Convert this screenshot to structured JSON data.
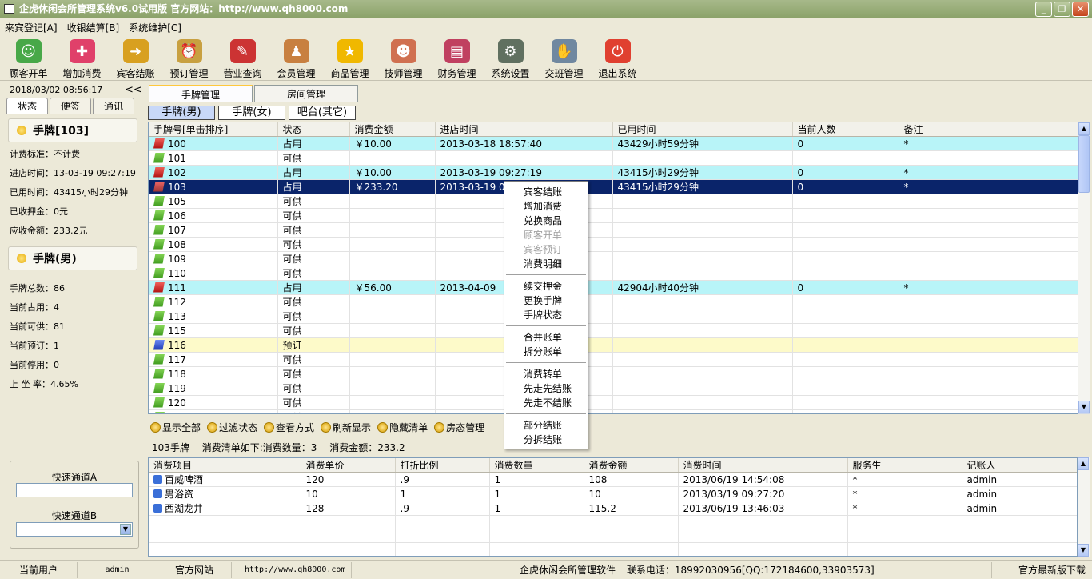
{
  "window": {
    "title": "企虎休闲会所管理系统v6.0试用版   官方网站：http://www.qh8000.com"
  },
  "menu": [
    "来宾登记[A]",
    "收银结算[B]",
    "系统维护[C]"
  ],
  "toolbar": [
    {
      "label": "顾客开单",
      "icon": "customer-icon",
      "color": "#48a848"
    },
    {
      "label": "增加消费",
      "icon": "add-icon",
      "color": "#e0406a"
    },
    {
      "label": "宾客结账",
      "icon": "checkout-icon",
      "color": "#d8a020"
    },
    {
      "label": "预订管理",
      "icon": "alarm-clock-icon",
      "color": "#c8a040"
    },
    {
      "label": "营业查询",
      "icon": "search-doc-icon",
      "color": "#cc3333"
    },
    {
      "label": "会员管理",
      "icon": "members-icon",
      "color": "#c88040"
    },
    {
      "label": "商品管理",
      "icon": "star-icon",
      "color": "#f0b800"
    },
    {
      "label": "技师管理",
      "icon": "staff-icon",
      "color": "#d07050"
    },
    {
      "label": "财务管理",
      "icon": "finance-icon",
      "color": "#c04060"
    },
    {
      "label": "系统设置",
      "icon": "settings-icon",
      "color": "#607060"
    },
    {
      "label": "交班管理",
      "icon": "handshake-icon",
      "color": "#7088a0"
    },
    {
      "label": "退出系统",
      "icon": "power-icon",
      "color": "#e04030"
    }
  ],
  "left": {
    "datetime": "2018/03/02 08:56:17",
    "collapse": "<<",
    "tabs": [
      "状态",
      "便签",
      "通讯"
    ],
    "card_title": "手牌[103]",
    "card": [
      "计费标准：不计费",
      "进店时间：13-03-19 09:27:19",
      "已用时间：43415小时29分钟",
      "已收押金：0元",
      "应收金额：233.2元"
    ],
    "group_title": "手牌(男)",
    "stats": [
      "手牌总数：86",
      "当前占用：4",
      "当前可供：81",
      "当前预订：1",
      "当前停用：0",
      "上 坐 率：4.65%"
    ],
    "quick_a": "快速通道A",
    "quick_b": "快速通道B"
  },
  "main_tabs": [
    "手牌管理",
    "房间管理"
  ],
  "sub_tabs": [
    "手牌(男)",
    "手牌(女)",
    "吧台(其它)"
  ],
  "grid": {
    "columns": [
      "手牌号[单击排序]",
      "状态",
      "消费金额",
      "进店时间",
      "已用时间",
      "当前人数",
      "备注"
    ],
    "rows": [
      {
        "flag": "red",
        "state": "occ",
        "cells": [
          "100",
          "占用",
          "￥10.00",
          "2013-03-18 18:57:40",
          "43429小时59分钟",
          "0",
          "*"
        ]
      },
      {
        "flag": "green",
        "state": "",
        "cells": [
          "101",
          "可供",
          "",
          "",
          "",
          "",
          ""
        ]
      },
      {
        "flag": "red",
        "state": "occ",
        "cells": [
          "102",
          "占用",
          "￥10.00",
          "2013-03-19 09:27:19",
          "43415小时29分钟",
          "0",
          "*"
        ]
      },
      {
        "flag": "redsel",
        "state": "sel",
        "cells": [
          "103",
          "占用",
          "￥233.20",
          "2013-03-19 09:27:19",
          "43415小时29分钟",
          "0",
          "*"
        ]
      },
      {
        "flag": "green",
        "state": "",
        "cells": [
          "105",
          "可供",
          "",
          "",
          "",
          "",
          ""
        ]
      },
      {
        "flag": "green",
        "state": "",
        "cells": [
          "106",
          "可供",
          "",
          "",
          "",
          "",
          ""
        ]
      },
      {
        "flag": "green",
        "state": "",
        "cells": [
          "107",
          "可供",
          "",
          "",
          "",
          "",
          ""
        ]
      },
      {
        "flag": "green",
        "state": "",
        "cells": [
          "108",
          "可供",
          "",
          "",
          "",
          "",
          ""
        ]
      },
      {
        "flag": "green",
        "state": "",
        "cells": [
          "109",
          "可供",
          "",
          "",
          "",
          "",
          ""
        ]
      },
      {
        "flag": "green",
        "state": "",
        "cells": [
          "110",
          "可供",
          "",
          "",
          "",
          "",
          ""
        ]
      },
      {
        "flag": "red",
        "state": "occ",
        "cells": [
          "111",
          "占用",
          "￥56.00",
          "2013-04-09",
          "42904小时40分钟",
          "0",
          "*"
        ]
      },
      {
        "flag": "green",
        "state": "",
        "cells": [
          "112",
          "可供",
          "",
          "",
          "",
          "",
          ""
        ]
      },
      {
        "flag": "green",
        "state": "",
        "cells": [
          "113",
          "可供",
          "",
          "",
          "",
          "",
          ""
        ]
      },
      {
        "flag": "green",
        "state": "",
        "cells": [
          "115",
          "可供",
          "",
          "",
          "",
          "",
          ""
        ]
      },
      {
        "flag": "blue",
        "state": "rsv",
        "cells": [
          "116",
          "预订",
          "",
          "",
          "",
          "",
          ""
        ]
      },
      {
        "flag": "green",
        "state": "",
        "cells": [
          "117",
          "可供",
          "",
          "",
          "",
          "",
          ""
        ]
      },
      {
        "flag": "green",
        "state": "",
        "cells": [
          "118",
          "可供",
          "",
          "",
          "",
          "",
          ""
        ]
      },
      {
        "flag": "green",
        "state": "",
        "cells": [
          "119",
          "可供",
          "",
          "",
          "",
          "",
          ""
        ]
      },
      {
        "flag": "green",
        "state": "",
        "cells": [
          "120",
          "可供",
          "",
          "",
          "",
          "",
          ""
        ]
      },
      {
        "flag": "green",
        "state": "",
        "cells": [
          "121",
          "可供",
          "",
          "",
          "",
          "",
          ""
        ]
      },
      {
        "flag": "green",
        "state": "",
        "cells": [
          "122",
          "可供",
          "",
          "",
          "",
          "",
          ""
        ]
      }
    ]
  },
  "actions": [
    "显示全部",
    "过滤状态",
    "查看方式",
    "刷新显示",
    "隐藏清单",
    "房态管理"
  ],
  "summary": {
    "card": "103手牌",
    "list": "消费清单如下:消费数量：3",
    "amount": "消费金额：233.2"
  },
  "detail": {
    "columns": [
      "消费项目",
      "消费单价",
      "打折比例",
      "消费数量",
      "消费金额",
      "消费时间",
      "服务生",
      "记账人"
    ],
    "rows": [
      [
        "百威啤酒",
        "120",
        ".9",
        "1",
        "108",
        "2013/06/19 14:54:08",
        "*",
        "admin"
      ],
      [
        "男浴资",
        "10",
        "1",
        "1",
        "10",
        "2013/03/19 09:27:20",
        "*",
        "admin"
      ],
      [
        "西湖龙井",
        "128",
        ".9",
        "1",
        "115.2",
        "2013/06/19 13:46:03",
        "*",
        "admin"
      ]
    ]
  },
  "context_menu": [
    {
      "label": "宾客结账",
      "enabled": true
    },
    {
      "label": "增加消费",
      "enabled": true
    },
    {
      "label": "兑换商品",
      "enabled": true
    },
    {
      "label": "顾客开单",
      "enabled": false
    },
    {
      "label": "宾客预订",
      "enabled": false
    },
    {
      "label": "消费明细",
      "enabled": true
    },
    {
      "sep": true
    },
    {
      "label": "续交押金",
      "enabled": true
    },
    {
      "label": "更换手牌",
      "enabled": true
    },
    {
      "label": "手牌状态",
      "enabled": true
    },
    {
      "sep": true
    },
    {
      "label": "合并账单",
      "enabled": true
    },
    {
      "label": "拆分账单",
      "enabled": true
    },
    {
      "sep": true
    },
    {
      "label": "消费转单",
      "enabled": true
    },
    {
      "label": "先走先结账",
      "enabled": true
    },
    {
      "label": "先走不结账",
      "enabled": true
    },
    {
      "sep": true
    },
    {
      "label": "部分结账",
      "enabled": true
    },
    {
      "label": "分拆结账",
      "enabled": true
    }
  ],
  "status": {
    "user_label": "当前用户",
    "user": "admin",
    "site_label": "官方网站",
    "site": "http://www.qh8000.com",
    "software": "企虎休闲会所管理软件",
    "phone": "联系电话：18992030956[QQ:172184600,33903573]",
    "download": "官方最新版下载"
  }
}
